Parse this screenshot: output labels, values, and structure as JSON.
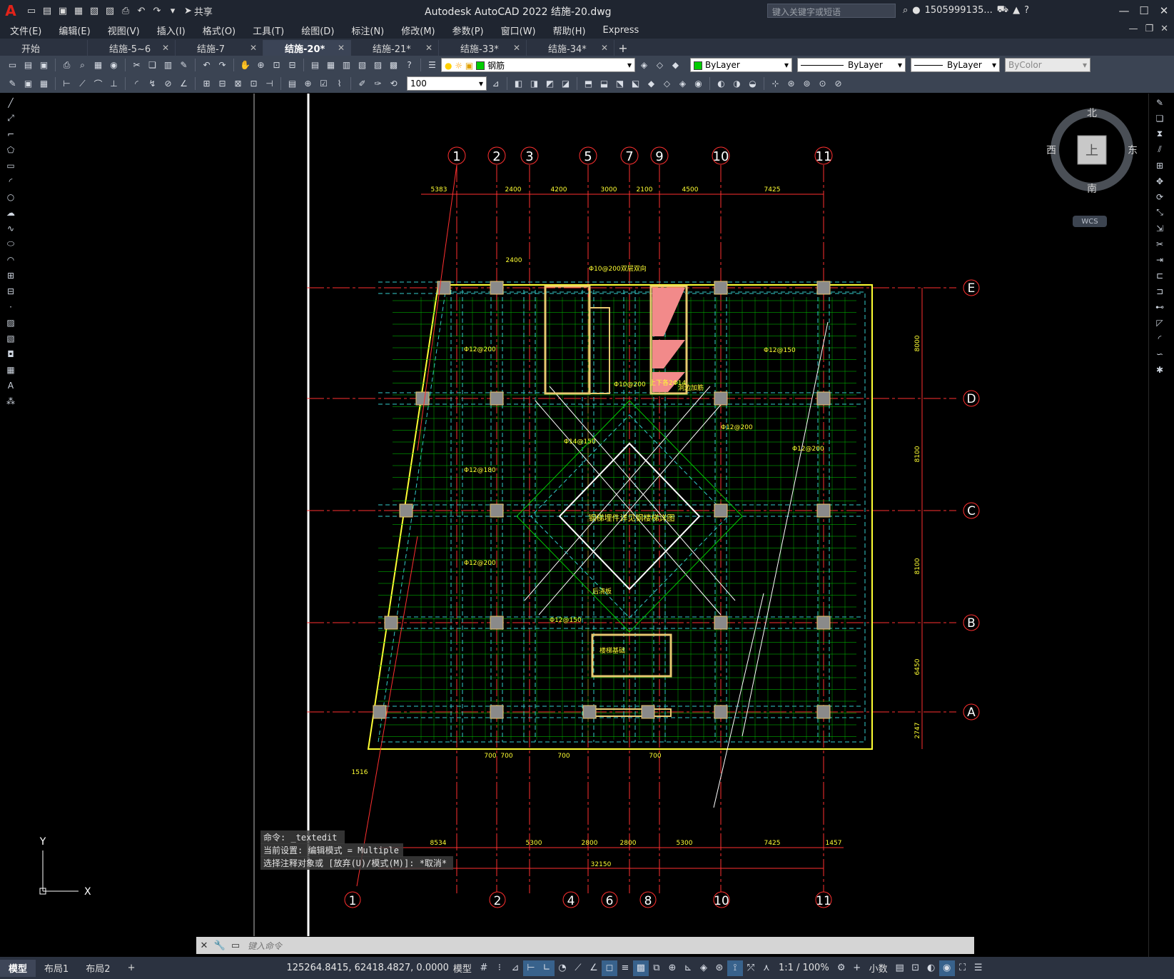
{
  "titlebar": {
    "logo": "A",
    "share_label": "共享",
    "title": "Autodesk AutoCAD 2022    结施-20.dwg",
    "search_placeholder": "键入关键字或短语",
    "user": "1505999135...",
    "qat_icons": [
      "new-icon",
      "open-icon",
      "save-icon",
      "saveas-icon",
      "plot-icon",
      "undo-icon",
      "redo-icon"
    ]
  },
  "menu": [
    "文件(E)",
    "编辑(E)",
    "视图(V)",
    "插入(I)",
    "格式(O)",
    "工具(T)",
    "绘图(D)",
    "标注(N)",
    "修改(M)",
    "参数(P)",
    "窗口(W)",
    "帮助(H)",
    "Express"
  ],
  "tabs": [
    {
      "label": "开始",
      "active": false,
      "closable": false
    },
    {
      "label": "结施-5~6",
      "active": false,
      "closable": true
    },
    {
      "label": "结施-7",
      "active": false,
      "closable": true
    },
    {
      "label": "结施-20*",
      "active": true,
      "closable": true
    },
    {
      "label": "结施-21*",
      "active": false,
      "closable": true
    },
    {
      "label": "结施-33*",
      "active": false,
      "closable": true
    },
    {
      "label": "结施-34*",
      "active": false,
      "closable": true
    }
  ],
  "layer": {
    "name": "钢筋",
    "color": "#00cc00"
  },
  "props": {
    "color": "ByLayer",
    "linetype": "ByLayer",
    "lineweight": "ByLayer",
    "plotstyle": "ByColor"
  },
  "dimscale": "100",
  "navcube": {
    "north": "北",
    "south": "南",
    "east": "东",
    "west": "西",
    "face": "上",
    "wcs": "WCS"
  },
  "axes_top": [
    "1",
    "2",
    "3",
    "5",
    "7",
    "9",
    "10",
    "11"
  ],
  "axes_right": [
    "E",
    "D",
    "C",
    "B",
    "A"
  ],
  "axes_bottom": [
    "1",
    "2",
    "4",
    "6",
    "8",
    "10",
    "11"
  ],
  "dims_top": [
    "5383",
    "2400",
    "4200",
    "3000",
    "2100",
    "4500",
    "7425"
  ],
  "dims_right": [
    "8000",
    "8100",
    "8100",
    "6450",
    "2747"
  ],
  "dims_bottom": [
    "8534",
    "5300",
    "2800",
    "2800",
    "5300",
    "7425",
    "1457"
  ],
  "dim_total": "32150",
  "dim_misc": [
    "2400",
    "1516",
    "700",
    "700",
    "700",
    "700"
  ],
  "center_note": "钢梯埋件详见钢楼梯详图",
  "rebar_labels": [
    "Φ12@200",
    "Φ10@200",
    "Φ12@150",
    "Φ12@180",
    "Φ14@150",
    "Φ10@200双层双向",
    "Φ12@150",
    "后浇板",
    "洞边加筋",
    "上下各2Φ14",
    "楼梯基础"
  ],
  "ucs": {
    "x": "X",
    "y": "Y"
  },
  "command": {
    "history": [
      "命令: _textedit",
      "当前设置: 编辑模式 = Multiple",
      "选择注释对象或 [放弃(U)/模式(M)]: *取消*"
    ],
    "placeholder": "键入命令"
  },
  "status": {
    "layouts": [
      "模型",
      "布局1",
      "布局2"
    ],
    "coords": "125264.8415, 62418.4827, 0.0000",
    "space": "模型",
    "scale": "1:1 / 100%",
    "units": "小数"
  }
}
